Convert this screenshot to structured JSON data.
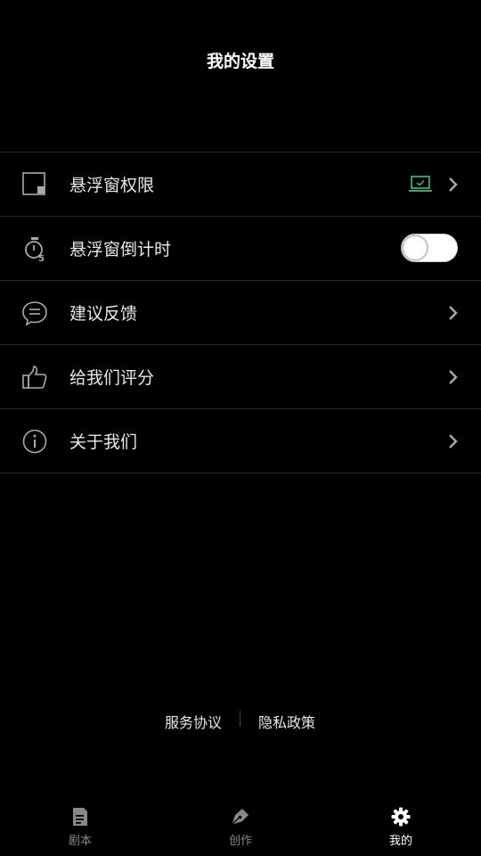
{
  "header": {
    "title": "我的设置"
  },
  "settings": {
    "items": [
      {
        "label": "悬浮窗权限",
        "icon": "window-icon",
        "trailing": "chevron",
        "badge_icon": "laptop-check-icon"
      },
      {
        "label": "悬浮窗倒计时",
        "icon": "timer-icon",
        "trailing": "toggle",
        "toggle_on": false
      },
      {
        "label": "建议反馈",
        "icon": "chat-bubble-icon",
        "trailing": "chevron"
      },
      {
        "label": "给我们评分",
        "icon": "thumbs-up-icon",
        "trailing": "chevron"
      },
      {
        "label": "关于我们",
        "icon": "info-icon",
        "trailing": "chevron"
      }
    ]
  },
  "footer_links": {
    "terms": "服务协议",
    "privacy": "隐私政策"
  },
  "tabbar": {
    "tabs": [
      {
        "label": "剧本",
        "icon": "script-icon",
        "active": false
      },
      {
        "label": "创作",
        "icon": "pen-nib-icon",
        "active": false
      },
      {
        "label": "我的",
        "icon": "gear-icon",
        "active": true
      }
    ]
  },
  "colors": {
    "background": "#000000",
    "accent_green": "#3fbf7f",
    "divider": "#262626",
    "inactive_tab": "#888888"
  }
}
